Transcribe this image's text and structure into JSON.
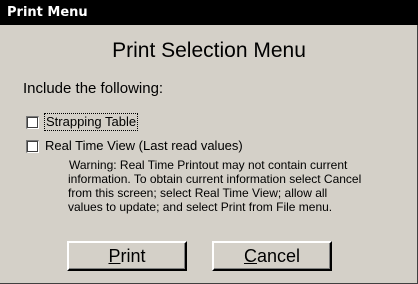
{
  "window": {
    "title": "Print Menu"
  },
  "heading": "Print Selection Menu",
  "intro": "Include the following:",
  "options": [
    {
      "label": "Strapping Table",
      "checked": false,
      "focused": true
    },
    {
      "label": "Real Time View (Last read values)",
      "checked": false,
      "focused": false
    }
  ],
  "warning": {
    "lines": [
      "Warning:  Real Time Printout may not contain current",
      "information.  To obtain current  information select Cancel",
      "from this screen; select Real Time View; allow all",
      "values to  update; and select Print from File menu."
    ]
  },
  "buttons": {
    "print": {
      "mnemonic": "P",
      "rest": "rint"
    },
    "cancel": {
      "mnemonic": "C",
      "rest": "ancel"
    }
  },
  "colors": {
    "titlebar_bg": "#000000",
    "dialog_bg": "#d4d0c8"
  }
}
